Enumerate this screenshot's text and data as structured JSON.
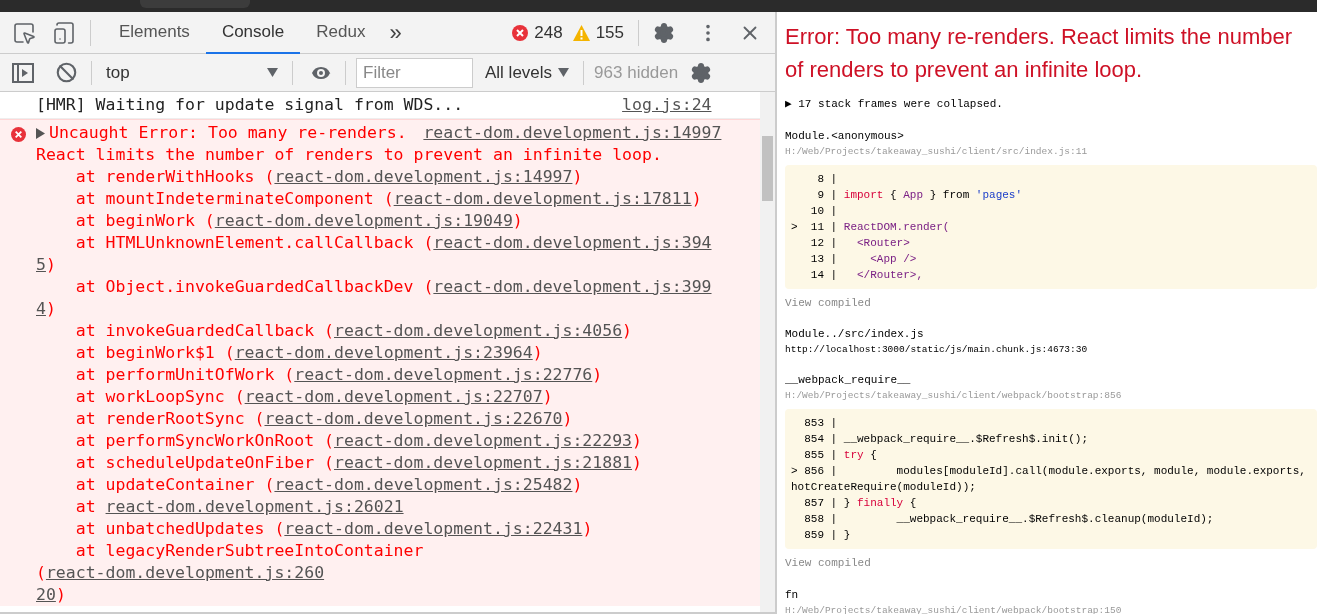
{
  "toolbar": {
    "tabs": [
      {
        "label": "Elements",
        "selected": false
      },
      {
        "label": "Console",
        "selected": true
      },
      {
        "label": "Redux",
        "selected": false
      }
    ],
    "more": "»",
    "errors": "248",
    "warnings": "155"
  },
  "filter_bar": {
    "context": "top",
    "filter": {
      "placeholder": "Filter"
    },
    "levels": "All levels",
    "hidden": "963 hidden"
  },
  "console": {
    "messages": [
      {
        "kind": "log",
        "text": "[HMR] Waiting for update signal from WDS...",
        "source": "log.js:24"
      },
      {
        "kind": "error",
        "message_lines": [
          "Uncaught Error: Too many re-renders.",
          "React limits the number of renders to prevent an infinite loop."
        ],
        "source": "react-dom.development.js:14997",
        "frames": [
          {
            "prefix": "at renderWithHooks (",
            "link": "react-dom.development.js:14997",
            "suffix": ")"
          },
          {
            "prefix": "at mountIndeterminateComponent (",
            "link": "react-dom.development.js:17811",
            "suffix": ")"
          },
          {
            "prefix": "at beginWork (",
            "link": "react-dom.development.js:19049",
            "suffix": ")"
          },
          {
            "prefix": "at HTMLUnknownElement.callCallback (",
            "link": [
              "react-dom.development.js:394",
              "5"
            ],
            "suffix": ")"
          },
          {
            "prefix": "at Object.invokeGuardedCallbackDev (",
            "link": [
              "react-dom.development.js:399",
              "4"
            ],
            "suffix": ")"
          },
          {
            "prefix": "at invokeGuardedCallback (",
            "link": "react-dom.development.js:4056",
            "suffix": ")"
          },
          {
            "prefix": "at beginWork$1 (",
            "link": "react-dom.development.js:23964",
            "suffix": ")"
          },
          {
            "prefix": "at performUnitOfWork (",
            "link": "react-dom.development.js:22776",
            "suffix": ")"
          },
          {
            "prefix": "at workLoopSync (",
            "link": "react-dom.development.js:22707",
            "suffix": ")"
          },
          {
            "prefix": "at renderRootSync (",
            "link": "react-dom.development.js:22670",
            "suffix": ")"
          },
          {
            "prefix": "at performSyncWorkOnRoot (",
            "link": "react-dom.development.js:22293",
            "suffix": ")"
          },
          {
            "prefix": "at scheduleUpdateOnFiber (",
            "link": "react-dom.development.js:21881",
            "suffix": ")"
          },
          {
            "prefix": "at updateContainer (",
            "link": "react-dom.development.js:25482",
            "suffix": ")"
          },
          {
            "prefix": "at ",
            "link": "react-dom.development.js:26021"
          },
          {
            "prefix": "at unbatchedUpdates (",
            "link": "react-dom.development.js:22431",
            "suffix": ")"
          },
          {
            "prefix": "at legacyRenderSubtreeIntoContainer (",
            "link": [
              "react-dom.development.js:260",
              "20"
            ],
            "suffix": ")"
          }
        ]
      }
    ]
  },
  "overlay": {
    "title": "Error: Too many re-renders. React limits the number of renders to prevent an infinite loop.",
    "collapsed_note": "▶ 17 stack frames were collapsed.",
    "frames": [
      {
        "function": "Module.<anonymous>",
        "location": "H:/Web/Projects/takeaway_sushi/client/src/index.js:11",
        "location_dim": true,
        "view_compiled": "View compiled",
        "code": [
          {
            "gutter": "8 |"
          },
          {
            "gutter": "9 |",
            "tokens": [
              {
                "kind": "keyword",
                "text": "import"
              },
              {
                "kind": "plain",
                "text": " { "
              },
              {
                "kind": "name",
                "text": "App"
              },
              {
                "kind": "plain",
                "text": " } from "
              },
              {
                "kind": "string",
                "text": "'pages'"
              }
            ]
          },
          {
            "gutter": "10 |"
          },
          {
            "marker": ">",
            "gutter": "11 |",
            "tokens": [
              {
                "kind": "name",
                "text": "ReactDOM.render("
              }
            ]
          },
          {
            "gutter": "12 |",
            "tokens": [
              {
                "kind": "name",
                "text": "  <Router>"
              }
            ]
          },
          {
            "gutter": "13 |",
            "tokens": [
              {
                "kind": "name",
                "text": "    <App />"
              }
            ]
          },
          {
            "gutter": "14 |",
            "tokens": [
              {
                "kind": "name",
                "text": "  </Router>,"
              }
            ]
          }
        ]
      },
      {
        "function": "Module../src/index.js",
        "location": "http://localhost:3000/static/js/main.chunk.js:4673:30",
        "location_dim": false
      },
      {
        "function": "__webpack_require__",
        "location": "H:/Web/Projects/takeaway_sushi/client/webpack/bootstrap:856",
        "location_dim": true,
        "view_compiled": "View compiled",
        "code": [
          {
            "gutter": "853 |"
          },
          {
            "gutter": "854 |",
            "tokens": [
              {
                "kind": "plain",
                "text": "__webpack_require__.$Refresh$.init();"
              }
            ]
          },
          {
            "gutter": "855 |",
            "tokens": [
              {
                "kind": "keyword",
                "text": "try"
              },
              {
                "kind": "plain",
                "text": " {"
              }
            ]
          },
          {
            "marker": ">",
            "gutter": "856 |",
            "tokens": [
              {
                "kind": "plain",
                "text": "        modules[moduleId].call(module.exports, module, module.exports, hotCreateRequire(moduleId));"
              }
            ]
          },
          {
            "gutter": "857 |",
            "tokens": [
              {
                "kind": "plain",
                "text": "} "
              },
              {
                "kind": "keyword",
                "text": "finally"
              },
              {
                "kind": "plain",
                "text": " {"
              }
            ]
          },
          {
            "gutter": "858 |",
            "tokens": [
              {
                "kind": "plain",
                "text": "        __webpack_require__.$Refresh$.cleanup(moduleId);"
              }
            ]
          },
          {
            "gutter": "859 |",
            "tokens": [
              {
                "kind": "plain",
                "text": "}"
              }
            ]
          }
        ]
      },
      {
        "function": "fn",
        "location": "H:/Web/Projects/takeaway_sushi/client/webpack/bootstrap:150",
        "location_dim": true
      }
    ]
  }
}
